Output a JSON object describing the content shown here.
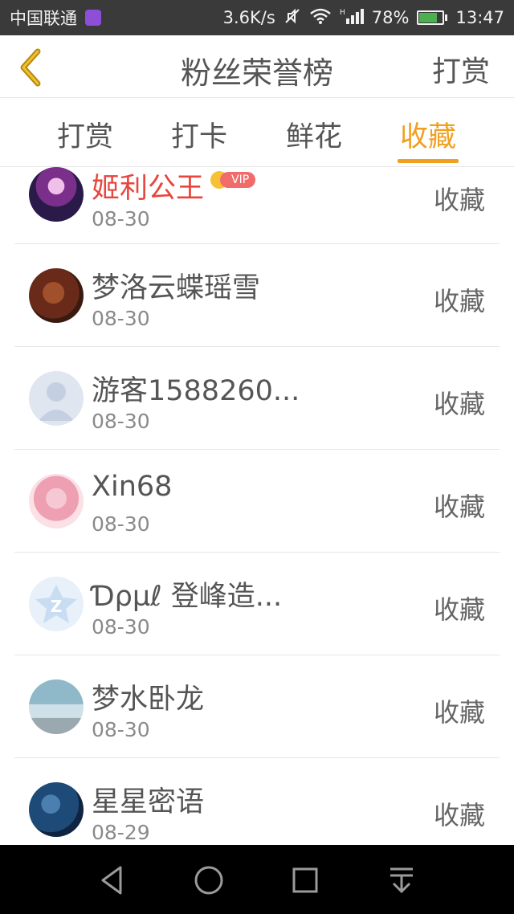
{
  "statusbar": {
    "carrier": "中国联通",
    "speed": "3.6K/s",
    "battery_percent": "78%",
    "time": "13:47",
    "battery_level": 0.78,
    "icons": [
      "app-icon",
      "mute-icon",
      "wifi-icon",
      "signal-icon",
      "battery-icon"
    ]
  },
  "navbar": {
    "title": "粉丝荣誉榜",
    "right_label": "打赏",
    "back_icon": "chevron-left-icon"
  },
  "tabs": [
    {
      "label": "打赏",
      "active": false
    },
    {
      "label": "打卡",
      "active": false
    },
    {
      "label": "鲜花",
      "active": false
    },
    {
      "label": "收藏",
      "active": true
    }
  ],
  "list": [
    {
      "name": "姬利公王",
      "date": "08-30",
      "action": "收藏",
      "vip": true,
      "vip_label": "VIP"
    },
    {
      "name": "梦洛云蝶瑶雪",
      "date": "08-30",
      "action": "收藏",
      "vip": false
    },
    {
      "name": "游客1588260...",
      "date": "08-30",
      "action": "收藏",
      "vip": false
    },
    {
      "name": "Xin68",
      "date": "08-30",
      "action": "收藏",
      "vip": false
    },
    {
      "name": "Ɗρµℓ 登峰造...",
      "date": "08-30",
      "action": "收藏",
      "vip": false
    },
    {
      "name": "梦水卧龙",
      "date": "08-30",
      "action": "收藏",
      "vip": false
    },
    {
      "name": "星星密语",
      "date": "08-29",
      "action": "收藏",
      "vip": false
    }
  ],
  "colors": {
    "accent": "#f0a020",
    "vip_name": "#e8453c",
    "statusbar_bg": "#3a3a3a",
    "sysnav_bg": "#000000"
  }
}
